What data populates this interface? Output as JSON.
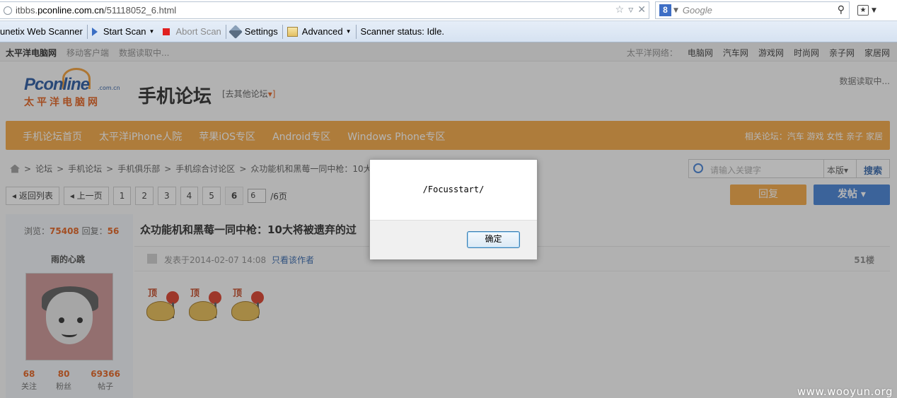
{
  "browser": {
    "url_prefix": "itbbs.",
    "url_domain": "pconline.com.cn",
    "url_path": "/51118052_6.html",
    "search_engine": "Google",
    "search_badge": "8"
  },
  "scanner": {
    "title": "unetix Web Scanner",
    "start_scan": "Start Scan",
    "abort_scan": "Abort Scan",
    "settings": "Settings",
    "advanced": "Advanced",
    "status": "Scanner status: Idle."
  },
  "site": {
    "topnav_left": [
      "太平洋电脑网",
      "移动客户端",
      "数据读取中..."
    ],
    "topnav_right": [
      "太平洋网络：",
      "电脑网",
      "汽车网",
      "游戏网",
      "时尚网",
      "亲子网",
      "家居网"
    ],
    "logo_word": "Pconline",
    "logo_domain": ".com.cn",
    "logo_cn": "太平洋电脑网",
    "forum_title": "手机论坛",
    "other_forum": "[去其他论坛",
    "other_forum_arrow": "▾]",
    "loading": "数据读取中...",
    "nav": [
      "手机论坛首页",
      "太平洋iPhone人院",
      "苹果iOS专区",
      "Android专区",
      "Windows Phone专区"
    ],
    "related": "相关论坛：汽车 游戏 女性 亲子 家居",
    "breadcrumb": [
      "论坛",
      "手机论坛",
      "手机俱乐部",
      "手机综合讨论区",
      "众功能机和黑莓一同中枪：10大将被"
    ],
    "search_placeholder": "请输入关键字",
    "search_scope": "本版▾",
    "search_btn": "搜索",
    "pager": {
      "back": "◂ 返回列表",
      "prev": "◂ 上一页",
      "pages": [
        "1",
        "2",
        "3",
        "4",
        "5",
        "6"
      ],
      "input": "6",
      "total": "/6页"
    },
    "reply_btn": "回复",
    "post_btn": "发帖 ▾",
    "views_label": "浏览：",
    "views": "75408",
    "replies_label": " 回复：",
    "replies": "56",
    "post_title": "众功能机和黑莓一同中枪：10大将被遗弃的过",
    "poster": "雨的心跳",
    "user_stats": [
      {
        "n": "68",
        "t": "关注"
      },
      {
        "n": "80",
        "t": "粉丝"
      },
      {
        "n": "69366",
        "t": "帖子"
      }
    ],
    "post_date": "发表于2014-02-07 14:08",
    "only_author": "只看该作者",
    "floor": "51楼",
    "emoji_text": "顶"
  },
  "dialog": {
    "message": "/Focusstart/",
    "ok": "确定"
  },
  "watermark": "www.wooyun.org"
}
